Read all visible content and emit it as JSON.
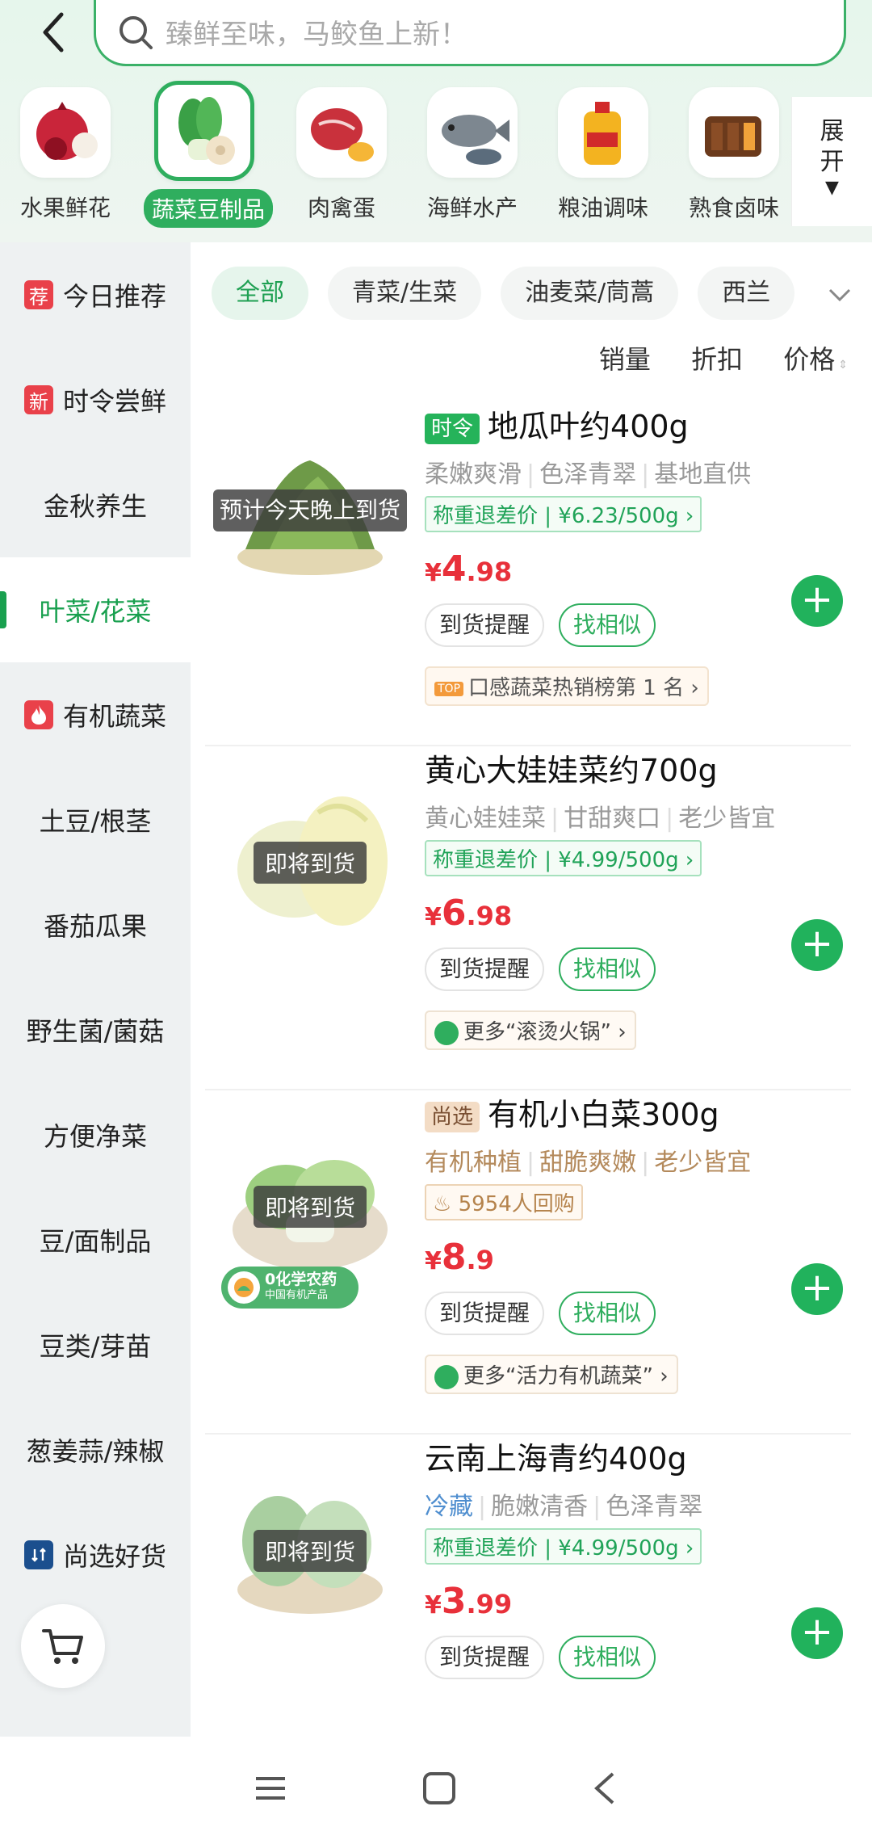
{
  "search": {
    "placeholder": "臻鲜至味，马鲛鱼上新！"
  },
  "categories": [
    {
      "label": "水果鲜花",
      "icon": "pomegranate-icon"
    },
    {
      "label": "蔬菜豆制品",
      "icon": "bok-choy-icon",
      "selected": true
    },
    {
      "label": "肉禽蛋",
      "icon": "meat-icon"
    },
    {
      "label": "海鲜水产",
      "icon": "fish-icon"
    },
    {
      "label": "粮油调味",
      "icon": "oil-bottle-icon"
    },
    {
      "label": "熟食卤味",
      "icon": "braised-meat-icon"
    }
  ],
  "expand_label": "展开",
  "sidebar": [
    {
      "label": "今日推荐",
      "tag": "荐"
    },
    {
      "label": "时令尝鲜",
      "tag": "新"
    },
    {
      "label": "金秋养生"
    },
    {
      "label": "叶菜/花菜",
      "active": true
    },
    {
      "label": "有机蔬菜",
      "tag": "fire"
    },
    {
      "label": "土豆/根茎"
    },
    {
      "label": "番茄瓜果"
    },
    {
      "label": "野生菌/菌菇"
    },
    {
      "label": "方便净菜"
    },
    {
      "label": "豆/面制品"
    },
    {
      "label": "豆类/芽苗"
    },
    {
      "label": "葱姜蒜/辣椒"
    },
    {
      "label": "尚选好货",
      "tag": "select"
    }
  ],
  "filters": [
    "全部",
    "青菜/生菜",
    "油麦菜/茼蒿",
    "西兰"
  ],
  "sort": {
    "sales": "销量",
    "discount": "折扣",
    "price": "价格"
  },
  "products": [
    {
      "prefix": "时令",
      "name": "地瓜叶约400g",
      "attrs": [
        "柔嫩爽滑",
        "色泽青翠",
        "基地直供"
      ],
      "weigh_price": "称重退差价 | ¥6.23/500g ›",
      "price_int": "4",
      "price_dec": ".98",
      "overlay": "预计今天晚上到货",
      "remind": "到货提醒",
      "similar": "找相似",
      "rank_tag": "TOP",
      "rank": "口感蔬菜热销榜第 1 名 ›"
    },
    {
      "name": "黄心大娃娃菜约700g",
      "attrs": [
        "黄心娃娃菜",
        "甘甜爽口",
        "老少皆宜"
      ],
      "weigh_price": "称重退差价 | ¥4.99/500g ›",
      "price_int": "6",
      "price_dec": ".98",
      "overlay": "即将到货",
      "remind": "到货提醒",
      "similar": "找相似",
      "more": "更多“滚烫火锅” ›"
    },
    {
      "prefix": "尚选",
      "name": "有机小白菜300g",
      "attrs": [
        "有机种植",
        "甜脆爽嫩",
        "老少皆宜"
      ],
      "repurchase": "5954人回购",
      "price_int": "8",
      "price_dec": ".9",
      "overlay": "即将到货",
      "organic_line1": "0化学农药",
      "organic_line2": "中国有机产品",
      "remind": "到货提醒",
      "similar": "找相似",
      "more": "更多“活力有机蔬菜” ›"
    },
    {
      "name": "云南上海青约400g",
      "cold": "冷藏",
      "attrs": [
        "脆嫩清香",
        "色泽青翠"
      ],
      "weigh_price": "称重退差价 | ¥4.99/500g ›",
      "price_int": "3",
      "price_dec": ".99",
      "overlay": "即将到货",
      "remind": "到货提醒",
      "similar": "找相似"
    }
  ],
  "colors": {
    "accent": "#2fae5e",
    "price": "#e8303a"
  }
}
